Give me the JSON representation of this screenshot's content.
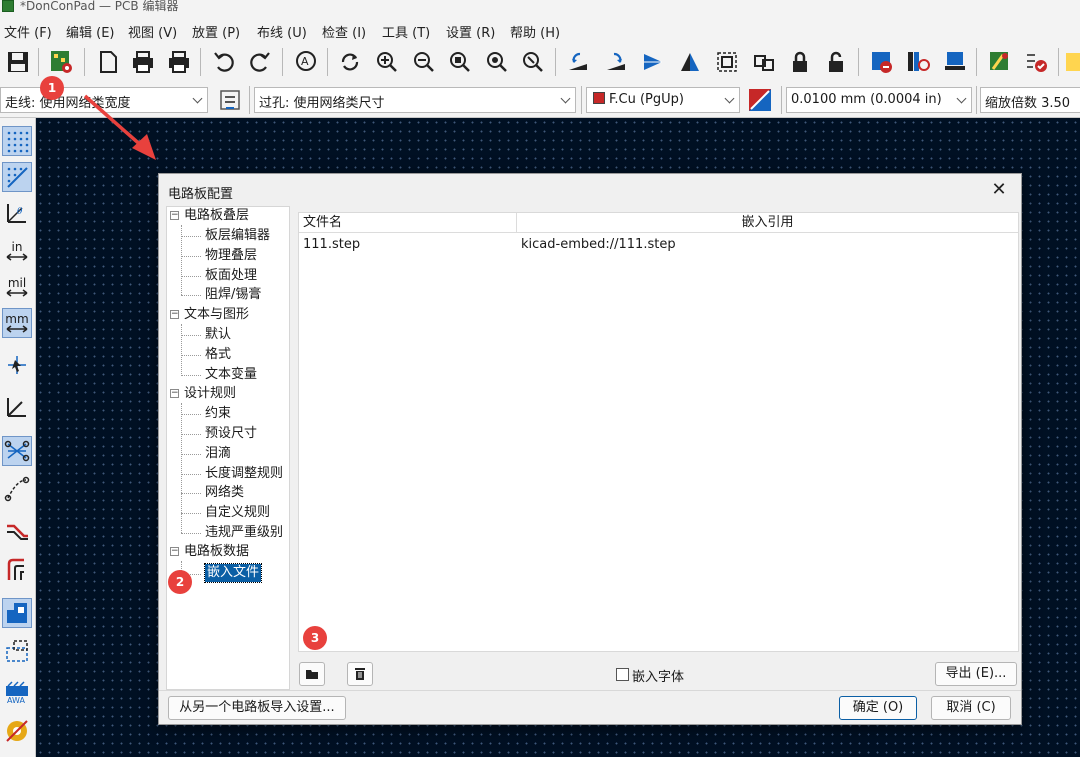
{
  "window": {
    "title": "*DonConPad — PCB 编辑器"
  },
  "menu": [
    "文件 (F)",
    "编辑 (E)",
    "视图 (V)",
    "放置 (P)",
    "布线 (U)",
    "检查 (I)",
    "工具 (T)",
    "设置 (R)",
    "帮助 (H)"
  ],
  "aux": {
    "track_width": "走线: 使用网络类宽度",
    "via_size": "过孔: 使用网络类尺寸",
    "layer": "F.Cu (PgUp)",
    "layer_color": "#c62828",
    "grid": "0.0100 mm (0.0004 in)",
    "zoom": "缩放倍数 3.50"
  },
  "left_toolbar": {
    "in_label": "in",
    "mil_label": "mil",
    "mm_label": "mm"
  },
  "dialog": {
    "title": "电路板配置",
    "close": "✕",
    "tree": {
      "stackup": "电路板叠层",
      "stackup_children": [
        "板层编辑器",
        "物理叠层",
        "板面处理",
        "阻焊/锡膏"
      ],
      "text": "文本与图形",
      "text_children": [
        "默认",
        "格式",
        "文本变量"
      ],
      "rules": "设计规则",
      "rules_children": [
        "约束",
        "预设尺寸",
        "泪滴",
        "长度调整规则",
        "网络类",
        "自定义规则",
        "违规严重级别"
      ],
      "data": "电路板数据",
      "data_children": [
        "嵌入文件"
      ]
    },
    "table": {
      "headers": [
        "文件名",
        "嵌入引用"
      ],
      "rows": [
        {
          "name": "111.step",
          "ref": "kicad-embed://111.step"
        }
      ]
    },
    "embed_fonts": "嵌入字体",
    "export_button": "导出 (E)...",
    "import_button": "从另一个电路板导入设置...",
    "ok_button": "确定 (O)",
    "cancel_button": "取消 (C)"
  },
  "annotations": {
    "badge1": "1",
    "badge2": "2",
    "badge3": "3",
    "color": "#e8413d"
  }
}
